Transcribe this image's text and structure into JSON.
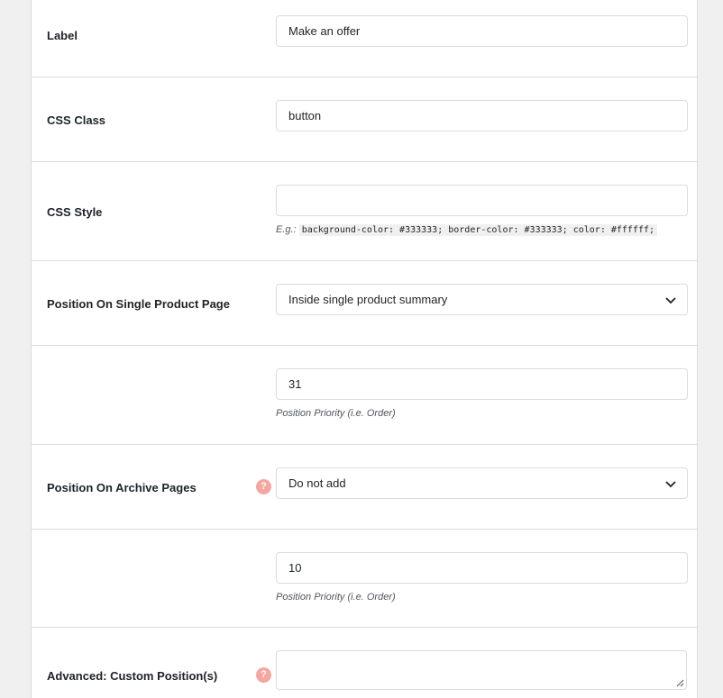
{
  "fields": {
    "label": {
      "label": "Label",
      "value": "Make an offer"
    },
    "css_class": {
      "label": "CSS Class",
      "value": "button"
    },
    "css_style": {
      "label": "CSS Style",
      "value": "",
      "example_prefix": "E.g.:",
      "example_code": "background-color: #333333; border-color: #333333; color: #ffffff;"
    },
    "position_single": {
      "label": "Position On Single Product Page",
      "selected": "Inside single product summary"
    },
    "priority_single": {
      "value": "31",
      "description": "Position Priority (i.e. Order)"
    },
    "position_archive": {
      "label": "Position On Archive Pages",
      "selected": "Do not add",
      "help": "?"
    },
    "priority_archive": {
      "value": "10",
      "description": "Position Priority (i.e. Order)"
    },
    "custom_positions": {
      "label": "Advanced: Custom Position(s)",
      "value": "",
      "help": "?"
    }
  },
  "icons": {
    "chevron": "chevron-down-icon",
    "help": "question-mark-icon",
    "resize": "resize-handle-icon"
  },
  "colors": {
    "help_badge": "#f4a6a0",
    "border": "#dcdcde",
    "background": "#f0f0f1"
  }
}
